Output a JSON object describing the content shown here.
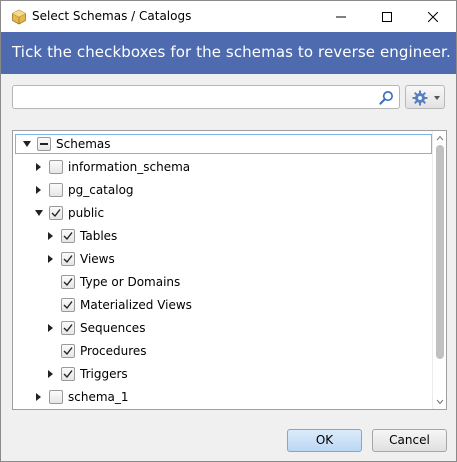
{
  "window": {
    "title": "Select Schemas / Catalogs",
    "icon": "app-package-icon"
  },
  "banner": {
    "text": "Tick the checkboxes for the schemas to reverse engineer.",
    "color": "#4d6bae"
  },
  "search": {
    "value": "",
    "placeholder": ""
  },
  "tree": {
    "root": {
      "label": "Schemas",
      "state": "indeterminate",
      "expanded": true
    },
    "nodes": [
      {
        "label": "information_schema",
        "checked": false,
        "expandable": true,
        "expanded": false
      },
      {
        "label": "pg_catalog",
        "checked": false,
        "expandable": true,
        "expanded": false
      },
      {
        "label": "public",
        "checked": true,
        "expandable": true,
        "expanded": true,
        "children": [
          {
            "label": "Tables",
            "checked": true,
            "expandable": true
          },
          {
            "label": "Views",
            "checked": true,
            "expandable": true
          },
          {
            "label": "Type or Domains",
            "checked": true,
            "expandable": false
          },
          {
            "label": "Materialized Views",
            "checked": true,
            "expandable": false
          },
          {
            "label": "Sequences",
            "checked": true,
            "expandable": true
          },
          {
            "label": "Procedures",
            "checked": true,
            "expandable": false
          },
          {
            "label": "Triggers",
            "checked": true,
            "expandable": true
          }
        ]
      },
      {
        "label": "schema_1",
        "checked": false,
        "expandable": true,
        "expanded": false
      }
    ]
  },
  "buttons": {
    "ok": "OK",
    "cancel": "Cancel"
  }
}
